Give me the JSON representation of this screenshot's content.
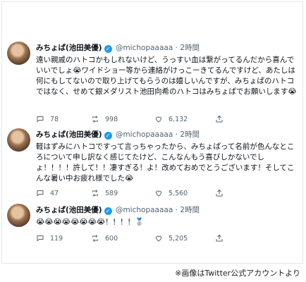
{
  "tweets": [
    {
      "name": "みちょぱ(池田美優)",
      "handle": "@michopaaaaa",
      "time": "· 2時間",
      "text": "遠い親戚のハトコかもしれないけど、うっすい血は繋がってるんだから喜んでいいでしょ😭ワイドショー等から連絡がけっこーきてるんですけど、あたしは何にもしてないので取り上げてもらうのは嬉しいんですが、みちょぱのハトコではなく、せめて銀メダリスト池田向希のハトコはみちょぱでお願いします😭",
      "replies": "78",
      "retweets": "998",
      "likes": "6,132"
    },
    {
      "name": "みちょぱ(池田美優)",
      "handle": "@michopaaaaa",
      "time": "· 2時間",
      "text": "軽はずみにハトコですって言っちゃったから、みちょぱって名前が色んなところについて申し訳なく感じてたけど、こんなんもう喜びしかないでしょ！！！！許して！！凄すぎる！よ！改めておめでとうございます！そしてこんな暑い中お疲れ様でした😭",
      "replies": "47",
      "retweets": "589",
      "likes": "5,560"
    },
    {
      "name": "みちょぱ(池田美優)",
      "handle": "@michopaaaaa",
      "time": "· 2時間",
      "text": "😭😭😭😭😭😭😭😭！！！！🥈",
      "replies": "119",
      "retweets": "600",
      "likes": "5,205"
    }
  ],
  "credit": "※画像はTwitter公式アカウントより",
  "colors": {
    "verified": "#1d9bf0",
    "muted": "#536471",
    "text": "#0f1419"
  },
  "icons": [
    "reply-icon",
    "retweet-icon",
    "like-icon",
    "share-icon",
    "verified-badge-icon"
  ]
}
